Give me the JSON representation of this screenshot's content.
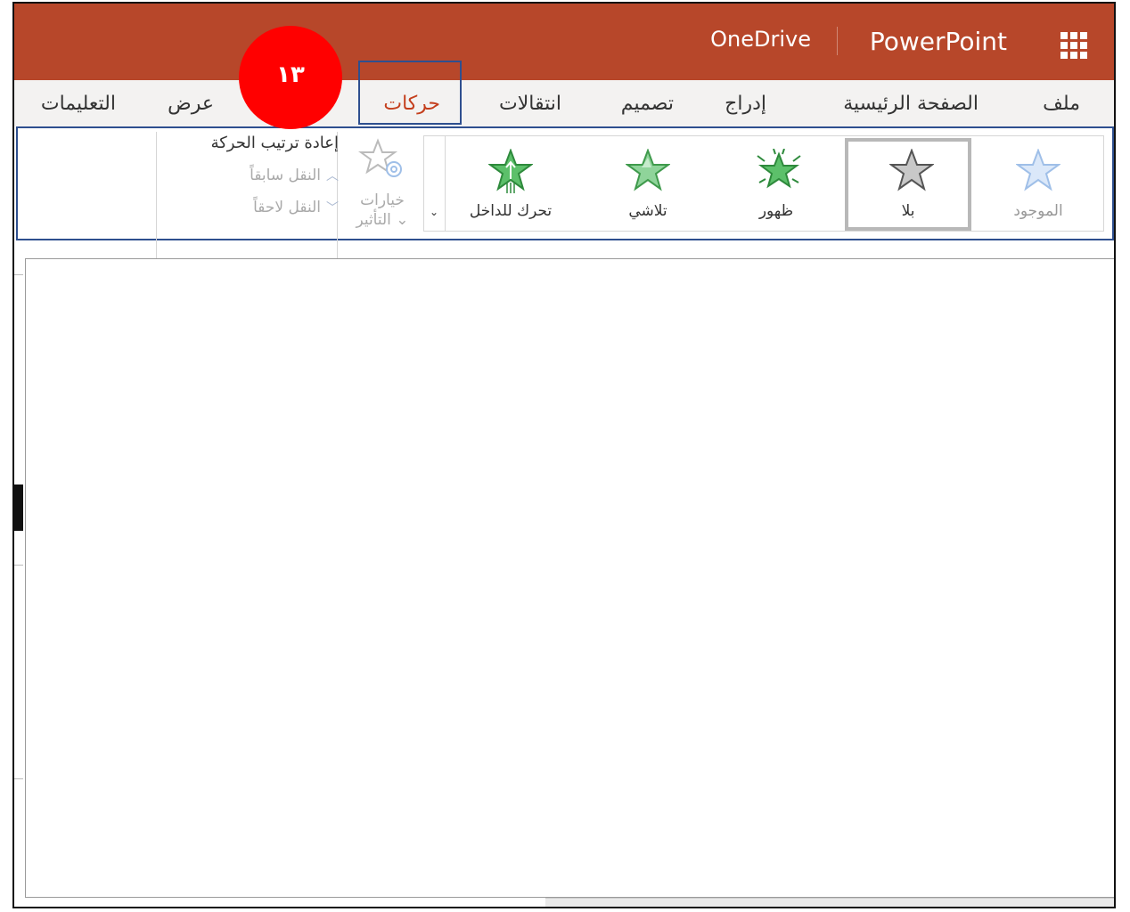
{
  "titlebar": {
    "onedrive": "OneDrive",
    "app_name": "PowerPoint",
    "accent_color": "#b7472a"
  },
  "tabs": [
    {
      "label": "ملف"
    },
    {
      "label": "الصفحة الرئيسية"
    },
    {
      "label": "إدراج"
    },
    {
      "label": "تصميم"
    },
    {
      "label": "انتقالات"
    },
    {
      "label": "حركات",
      "active": true
    },
    {
      "label": "عرض"
    },
    {
      "label": "التعليمات"
    }
  ],
  "animations_gallery": [
    {
      "label": "الموجود",
      "icon": "star-existing-icon",
      "state": "disabled"
    },
    {
      "label": "بلا",
      "icon": "star-none-icon",
      "state": "selected"
    },
    {
      "label": "ظهور",
      "icon": "star-appear-icon"
    },
    {
      "label": "تلاشي",
      "icon": "star-fade-icon"
    },
    {
      "label": "تحرك للداخل",
      "icon": "star-fly-in-icon"
    }
  ],
  "effect_options": {
    "line1": "خيارات",
    "line2": "التأثير ⌄"
  },
  "reorder": {
    "title": "إعادة ترتيب الحركة",
    "move_earlier": "النقل سابقاً",
    "move_later": "النقل لاحقاً"
  },
  "callout": {
    "number": "١٣",
    "color": "#ff0000"
  }
}
